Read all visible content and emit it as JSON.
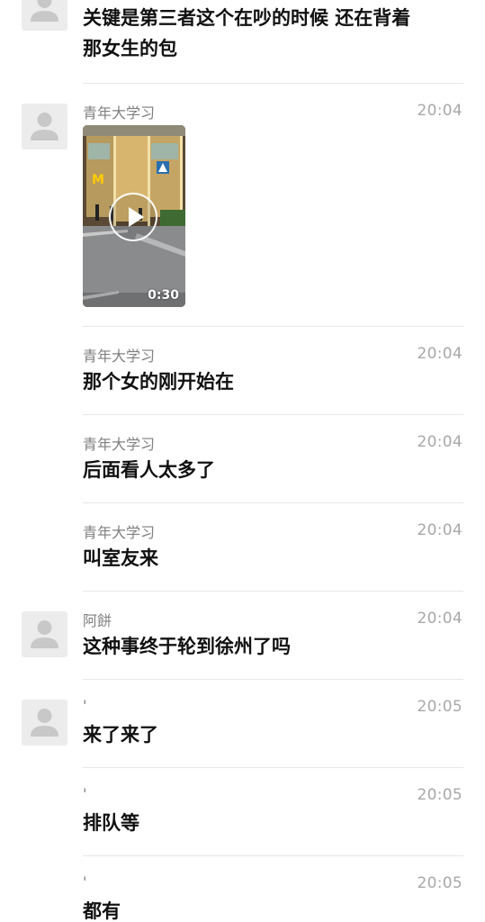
{
  "messages": [
    {
      "sender": "",
      "time": "",
      "text": "关键是第三者这个在吵的时候 还在背着",
      "text2": "那女生的包",
      "has_avatar": true
    },
    {
      "sender": "青年大学习",
      "time": "20:04",
      "video_duration": "0:30",
      "has_avatar": true
    },
    {
      "sender": "青年大学习",
      "time": "20:04",
      "text": "那个女的刚开始在",
      "has_avatar": false
    },
    {
      "sender": "青年大学习",
      "time": "20:04",
      "text": "后面看人太多了",
      "has_avatar": false
    },
    {
      "sender": "青年大学习",
      "time": "20:04",
      "text": "叫室友来",
      "has_avatar": false
    },
    {
      "sender": "阿餅",
      "time": "20:04",
      "text": "这种事终于轮到徐州了吗",
      "has_avatar": true
    },
    {
      "sender": "'",
      "time": "20:05",
      "text": "来了来了",
      "has_avatar": true
    },
    {
      "sender": "'",
      "time": "20:05",
      "text": "排队等",
      "has_avatar": false
    },
    {
      "sender": "'",
      "time": "20:05",
      "text": "都有",
      "has_avatar": false
    }
  ],
  "colors": {
    "avatar_bg": "#ececec",
    "avatar_icon": "#c8c8c8",
    "divider": "#e7e7e7",
    "timestamp": "#a8a8a8",
    "sender": "#7f7f7f"
  },
  "icons": {
    "avatar": "default-user-silhouette-icon",
    "video_play": "play-circle-icon"
  }
}
